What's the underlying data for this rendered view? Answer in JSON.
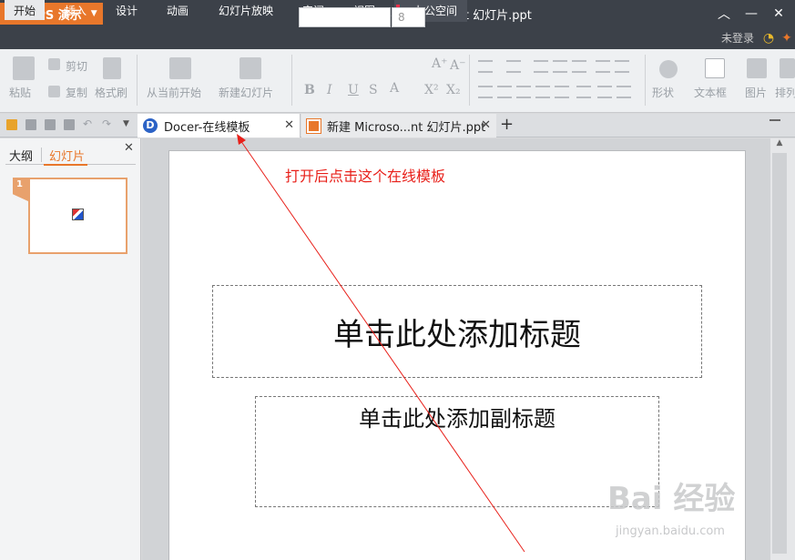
{
  "window": {
    "app_button": "WPS 演示",
    "title": "新建 Microsoft PowerPoint 幻灯片.ppt"
  },
  "menu": {
    "tabs": [
      "开始",
      "插入",
      "设计",
      "动画",
      "幻灯片放映",
      "审阅",
      "视图",
      "办公空间"
    ],
    "active_tab": "开始",
    "login": "未登录"
  },
  "ribbon": {
    "paste": "粘贴",
    "cut": "剪切",
    "copy": "复制",
    "format_painter": "格式刷",
    "from_current": "从当前开始",
    "new_slide": "新建幻灯片",
    "font_name": "",
    "font_size": "8",
    "shape": "形状",
    "textbox": "文本框",
    "picture": "图片",
    "arrange": "排列"
  },
  "doc_tabs": [
    {
      "label": "Docer-在线模板",
      "active": true
    },
    {
      "label": "新建 Microso...nt 幻灯片.ppt",
      "active": false
    }
  ],
  "left_pane": {
    "tab_outline": "大纲",
    "tab_slides": "幻灯片",
    "slide_number": "1"
  },
  "slide": {
    "title_placeholder": "单击此处添加标题",
    "subtitle_placeholder": "单击此处添加副标题"
  },
  "annotation": {
    "text": "打开后点击这个在线模板",
    "color": "#e8201a"
  },
  "watermark": {
    "logo": "Baidu经验",
    "url": "jingyan.baidu.com"
  },
  "colors": {
    "accent": "#e8772b",
    "titlebar": "#3c4149"
  }
}
